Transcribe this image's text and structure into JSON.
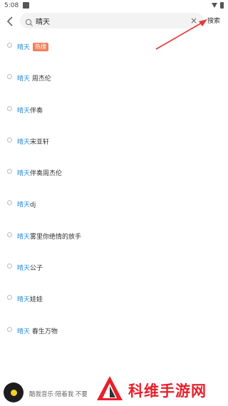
{
  "status_bar": {
    "time": "5:08"
  },
  "search": {
    "query": "晴天",
    "clear_label": "×",
    "submit_label": "搜索"
  },
  "suggestions": [
    {
      "highlight": "晴天",
      "rest": "",
      "badge": "热搜"
    },
    {
      "highlight": "晴天",
      "rest": " 周杰伦"
    },
    {
      "highlight": "晴天",
      "rest": "伴奏"
    },
    {
      "highlight": "晴天",
      "rest": "宋亚轩"
    },
    {
      "highlight": "晴天",
      "rest": "伴奏周杰伦"
    },
    {
      "highlight": "晴天",
      "rest": "dj"
    },
    {
      "highlight": "晴天",
      "rest": "雾里你绝情的放手"
    },
    {
      "highlight": "晴天",
      "rest": "公子"
    },
    {
      "highlight": "晴天",
      "rest": "娃娃"
    },
    {
      "highlight": "晴天",
      "rest": " 春生万物"
    }
  ],
  "player": {
    "text": "酷我音乐·陪着我 不要"
  },
  "watermark": {
    "text": "科维手游网"
  },
  "colors": {
    "highlight": "#2a8fd8",
    "badge": "#f0805c",
    "arrow": "#e53935",
    "watermark": "#e8202a"
  }
}
